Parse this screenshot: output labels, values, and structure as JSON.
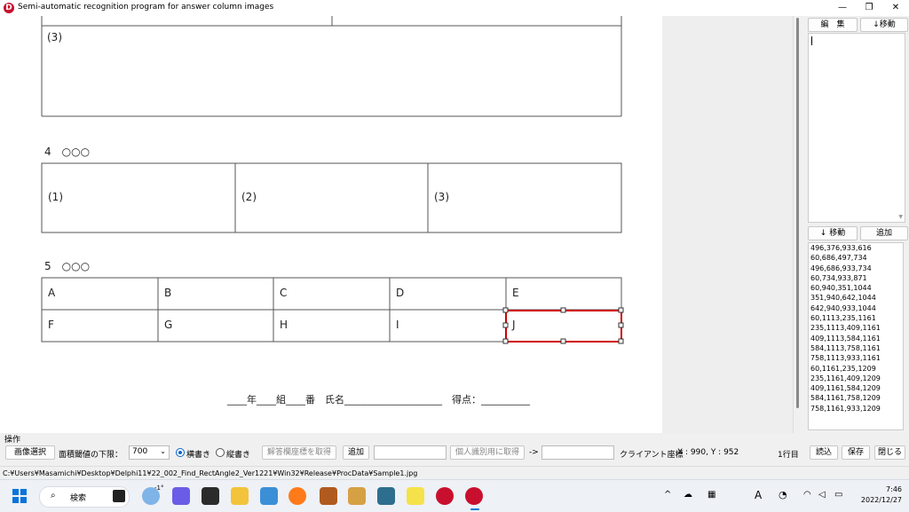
{
  "window": {
    "title": "Semi-automatic recognition program for answer column images",
    "app_icon_letter": "D",
    "min_glyph": "—",
    "max_glyph": "❐",
    "close_glyph": "✕"
  },
  "document": {
    "section3_cell": "(3)",
    "section4": {
      "heading": "4　○○○",
      "cells": [
        "(1)",
        "(2)",
        "(3)"
      ]
    },
    "section5": {
      "heading": "5　○○○",
      "row1": [
        "A",
        "B",
        "C",
        "D",
        "E"
      ],
      "row2": [
        "F",
        "G",
        "H",
        "I",
        "J"
      ]
    },
    "footer_line": "____年____組____番　氏名____________________　得点：__________"
  },
  "right_panel": {
    "edit_button": "編　集",
    "move_down_top_button": "↓移動",
    "move_down_bottom_button": "↓ 移動",
    "add_button": "追加",
    "coordinates": [
      "496,376,933,616",
      "60,686,497,734",
      "496,686,933,734",
      "60,734,933,871",
      "60,940,351,1044",
      "351,940,642,1044",
      "642,940,933,1044",
      "60,1113,235,1161",
      "235,1113,409,1161",
      "409,1113,584,1161",
      "584,1113,758,1161",
      "758,1113,933,1161",
      "60,1161,235,1209",
      "235,1161,409,1209",
      "409,1161,584,1209",
      "584,1161,758,1209",
      "758,1161,933,1209"
    ]
  },
  "operations": {
    "group_label": "操作",
    "select_image_button": "画像選択",
    "area_threshold_label": "面積閾値の下限：",
    "area_threshold_value": "700",
    "radio_horizontal": "横書き",
    "radio_vertical": "縦書き",
    "get_answer_coords_button": "解答欄座標を取得",
    "add_button": "追加",
    "get_personal_id_button": "個人識別用に取得",
    "arrow": "->",
    "client_coords_label": "クライアント座標",
    "client_coords_value": "X : 990, Y : 952",
    "line_indicator": "1行目",
    "load_button": "読込",
    "save_button": "保存",
    "close_button": "閉じる"
  },
  "status": {
    "path": "C:¥Users¥Masamichi¥Desktop¥Delphi11¥22_002_Find_RectAngle2_Ver1221¥Win32¥Release¥ProcData¥Sample1.jpg"
  },
  "taskbar": {
    "search_label": "検索",
    "weather_temp": "-1°",
    "ime_label": "A",
    "time": "7:46",
    "date": "2022/12/27"
  }
}
